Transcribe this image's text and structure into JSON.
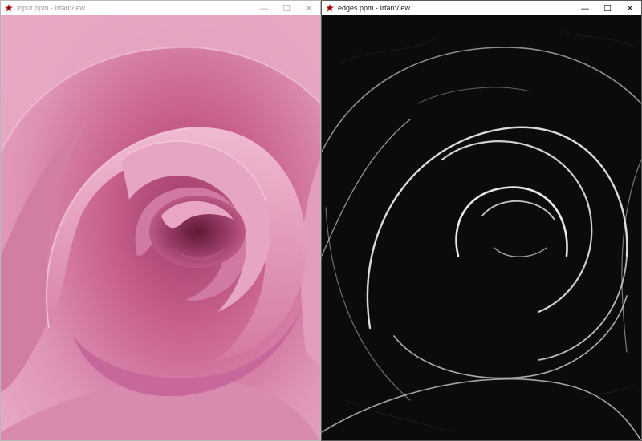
{
  "windows": [
    {
      "title": "input.ppm - IrfanView",
      "active": false,
      "image": {
        "name": "input.ppm",
        "subject": "pink rose close-up"
      }
    },
    {
      "title": "edges.ppm - IrfanView",
      "active": true,
      "image": {
        "name": "edges.ppm",
        "subject": "edge-detected rose"
      }
    }
  ],
  "controls": {
    "minimize": "—",
    "maximize": "☐",
    "close": "✕"
  },
  "icons": {
    "app": "irfanview-icon",
    "minimize": "minimize-icon",
    "maximize": "maximize-icon",
    "close": "close-icon"
  },
  "colors": {
    "rose_pink": "#d2789e",
    "rose_dark": "#8c2f58",
    "edge_bg": "#0b0b0b",
    "edge_line": "#e6e6e6"
  }
}
